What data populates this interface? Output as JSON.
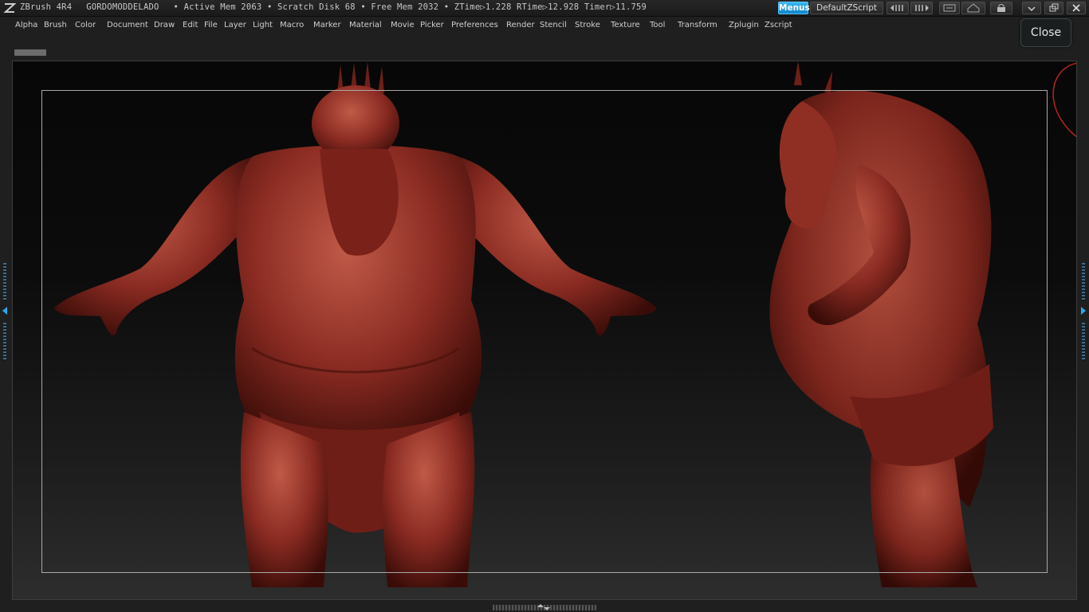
{
  "app": {
    "name": "ZBrush 4R4",
    "document": "GORDOMODDELADO"
  },
  "status": {
    "active_mem": "• Active Mem 2063",
    "scratch_disk": "• Scratch Disk 68",
    "free_mem": "• Free Mem 2032",
    "ztime": "• ZTime▷1.228",
    "rtime": "RTime▷12.928",
    "timer": "Timer▷11.759"
  },
  "toolbar": {
    "menus_label": "Menus",
    "script_label": "DefaultZScript"
  },
  "menu": [
    "Alpha",
    "Brush",
    "Color",
    "Document",
    "Draw",
    "Edit",
    "File",
    "Layer",
    "Light",
    "Macro",
    "Marker",
    "Material",
    "Movie",
    "Picker",
    "Preferences",
    "Render",
    "Stencil",
    "Stroke",
    "Texture",
    "Tool",
    "Transform",
    "Zplugin",
    "Zscript"
  ],
  "close_label": "Close",
  "colors": {
    "accent": "#1a9ee0",
    "model_base": "#8a2b22",
    "model_highlight": "#c05a48",
    "model_shadow": "#3a0c08"
  },
  "icons": [
    "zbrush-logo-icon",
    "dock-left-icon",
    "dock-right-icon",
    "help-icon",
    "home-icon",
    "lock-icon",
    "minimize-icon",
    "restore-icon",
    "close-window-icon"
  ]
}
